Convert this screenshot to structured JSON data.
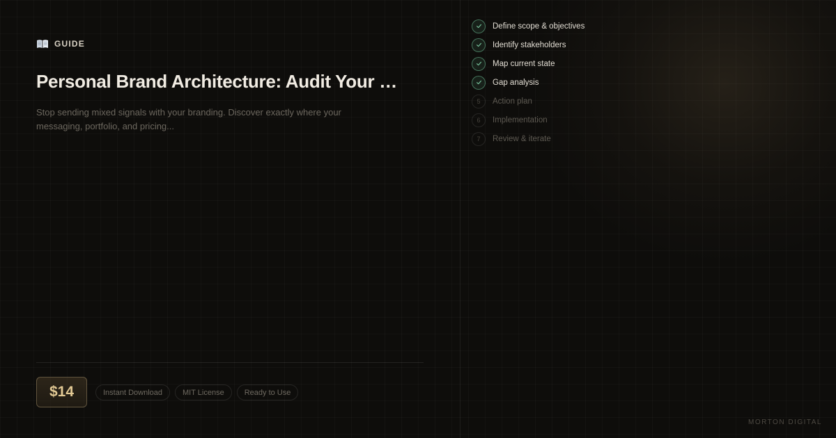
{
  "header": {
    "kicker_icon": "book-icon",
    "kicker_label": "GUIDE"
  },
  "product": {
    "title": "Personal Brand Architecture: Audit Your …",
    "description": "Stop sending mixed signals with your branding. Discover exactly where your messaging, portfolio, and pricing...",
    "price": "$14",
    "badges": [
      "Instant Download",
      "MIT License",
      "Ready to Use"
    ]
  },
  "steps": [
    {
      "number": "1",
      "label": "Define scope & objectives",
      "status": "done"
    },
    {
      "number": "2",
      "label": "Identify stakeholders",
      "status": "done"
    },
    {
      "number": "3",
      "label": "Map current state",
      "status": "done"
    },
    {
      "number": "4",
      "label": "Gap analysis",
      "status": "done"
    },
    {
      "number": "5",
      "label": "Action plan",
      "status": "todo"
    },
    {
      "number": "6",
      "label": "Implementation",
      "status": "todo"
    },
    {
      "number": "7",
      "label": "Review & iterate",
      "status": "todo"
    }
  ],
  "footer": {
    "brand": "MORTON DIGITAL"
  },
  "colors": {
    "background": "#0e0d0b",
    "accent_gold": "#e2c994",
    "check_green": "#6ebe96",
    "title_text": "#f1ece3"
  }
}
